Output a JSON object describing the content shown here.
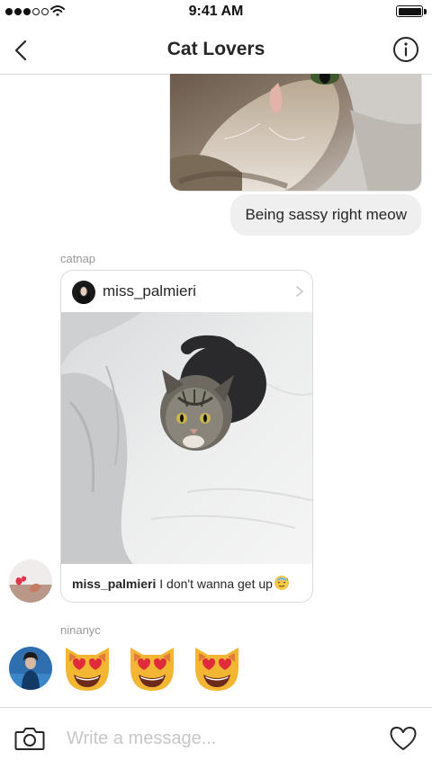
{
  "status_bar": {
    "time": "9:41 AM",
    "signal_bars_filled": 3,
    "signal_bars_total": 5,
    "icons": [
      "signal-dots-icon",
      "wifi-icon",
      "battery-icon"
    ]
  },
  "header": {
    "title": "Cat Lovers",
    "icons": [
      "back-chevron-icon",
      "info-icon"
    ]
  },
  "messages": [
    {
      "type": "photo",
      "side": "right",
      "image": "cat close-up photo"
    },
    {
      "type": "text",
      "side": "right",
      "text": "Being sassy right meow"
    },
    {
      "type": "shared_post",
      "sender": "catnap",
      "post": {
        "username": "miss_palmieri",
        "image": "tabby cat on white bed sheets",
        "caption_user": "miss_palmieri",
        "caption_text": "I don't wanna get up",
        "caption_emoji": "sweat-smile-emoji"
      }
    },
    {
      "type": "emoji",
      "sender": "ninanyc",
      "emojis": [
        "heart-eyes-cat-emoji",
        "heart-eyes-cat-emoji",
        "heart-eyes-cat-emoji"
      ]
    }
  ],
  "composer": {
    "placeholder": "Write a message...",
    "icons": [
      "camera-icon",
      "heart-icon"
    ]
  },
  "colors": {
    "bubble_gray": "#efefef",
    "divider": "#dbdbdb",
    "secondary_text": "#999999",
    "placeholder_text": "#c7c7c7"
  }
}
